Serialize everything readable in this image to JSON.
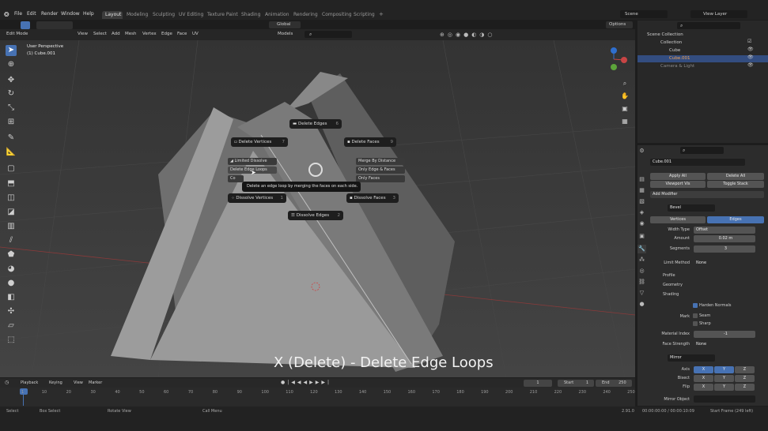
{
  "topbar": {
    "menus": [
      "File",
      "Edit",
      "Render",
      "Window",
      "Help"
    ],
    "workspaces": [
      "Layout",
      "Modeling",
      "Sculpting",
      "UV Editing",
      "Texture Paint",
      "Shading",
      "Animation",
      "Rendering",
      "Compositing",
      "Scripting"
    ],
    "active_workspace": "Layout",
    "scene": "Scene",
    "view_layer": "View Layer"
  },
  "header": {
    "mode": "Edit Mode",
    "menus": [
      "View",
      "Select",
      "Add",
      "Mesh",
      "Vertex",
      "Edge",
      "Face",
      "UV"
    ],
    "orientation": "Global",
    "models": "Models",
    "options": "Options"
  },
  "viewport": {
    "perspective": "User Perspective",
    "object": "(1) Cube.001",
    "caption": "X (Delete) - Delete Edge Loops"
  },
  "pie": {
    "delete_edges": {
      "label": "Delete Edges",
      "key": "6"
    },
    "delete_vertices": {
      "label": "Delete Vertices",
      "key": "7"
    },
    "delete_faces": {
      "label": "Delete Faces",
      "key": "9"
    },
    "dissolve_vertices": {
      "label": "Dissolve Vertices",
      "key": "1"
    },
    "dissolve_faces": {
      "label": "Dissolve Faces",
      "key": "3"
    },
    "dissolve_edges": {
      "label": "Dissolve Edges",
      "key": "2"
    },
    "limited_dissolve": "Limited Dissolve",
    "delete_edge_loops": "Delete Edge Loops",
    "collapse": "Co",
    "merge_by_distance": "Merge By Distance",
    "only_edges_faces": "Only Edge & Faces",
    "only_faces": "Only Faces",
    "tooltip": "Delete an edge loop by merging the faces on each side."
  },
  "timeline": {
    "menus": [
      "Playback",
      "Keying",
      "View",
      "Marker"
    ],
    "current_frame": "1",
    "start_label": "Start",
    "start": "1",
    "end_label": "End",
    "end": "250",
    "ticks": [
      "1",
      "10",
      "20",
      "30",
      "40",
      "50",
      "60",
      "70",
      "80",
      "90",
      "100",
      "110",
      "120",
      "130",
      "140",
      "150",
      "160",
      "170",
      "180",
      "190",
      "200",
      "210",
      "220",
      "230",
      "240",
      "250"
    ]
  },
  "statusbar": {
    "items": [
      "Select",
      "Box Select",
      "Rotate View",
      "Call Menu"
    ],
    "version": "2.91.0",
    "time": "00:00:00:00 / 00:00:10:09",
    "frame": "Start Frame (249 left)"
  },
  "outliner": {
    "rows": [
      "Scene Collection",
      "Collection",
      "Cube",
      "Cube.001",
      "Camera & Light"
    ]
  },
  "properties": {
    "object_name": "Cube.001",
    "apply_all": "Apply All",
    "delete_all": "Delete All",
    "viewport_vis": "Viewport Vis",
    "toggle_stack": "Toggle Stack",
    "add_modifier": "Add Modifier",
    "bevel": "Bevel",
    "vertices_tab": "Vertices",
    "edges_tab": "Edges",
    "width_type_label": "Width Type",
    "width_type": "Offset",
    "amount_label": "Amount",
    "amount": "0.02 m",
    "segments_label": "Segments",
    "segments": "3",
    "limit_method_label": "Limit Method",
    "limit_method": "None",
    "profile": "Profile",
    "geometry": "Geometry",
    "shading": "Shading",
    "harden_normals": "Harden Normals",
    "mark_label": "Mark",
    "seam": "Seam",
    "sharp": "Sharp",
    "material_index_label": "Material Index",
    "material_index": "-1",
    "face_strength_label": "Face Strength",
    "face_strength": "None",
    "mirror": "Mirror",
    "axis_label": "Axis",
    "bisect_label": "Bisect",
    "flip_label": "Flip",
    "x": "X",
    "y": "Y",
    "z": "Z",
    "mirror_object_label": "Mirror Object"
  }
}
